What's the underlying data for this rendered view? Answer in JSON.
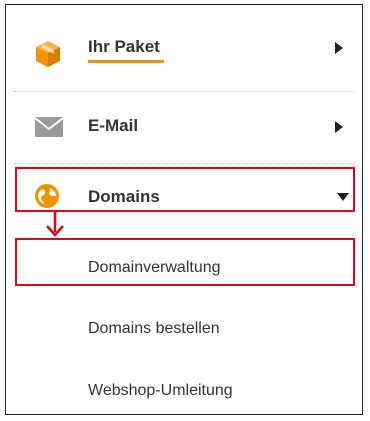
{
  "menu": {
    "paket": {
      "label": "Ihr Paket",
      "icon": "package-icon",
      "accent": "#f39200"
    },
    "email": {
      "label": "E-Mail",
      "icon": "envelope-icon"
    },
    "domains": {
      "label": "Domains",
      "icon": "globe-icon",
      "expanded": true
    }
  },
  "submenu": {
    "items": [
      {
        "label": "Domainverwaltung",
        "highlighted": true
      },
      {
        "label": "Domains bestellen"
      },
      {
        "label": "Webshop-Umleitung"
      }
    ]
  },
  "colors": {
    "accent": "#f39200",
    "highlight": "#e30613",
    "text": "#333333",
    "icon_gray": "#999999"
  }
}
